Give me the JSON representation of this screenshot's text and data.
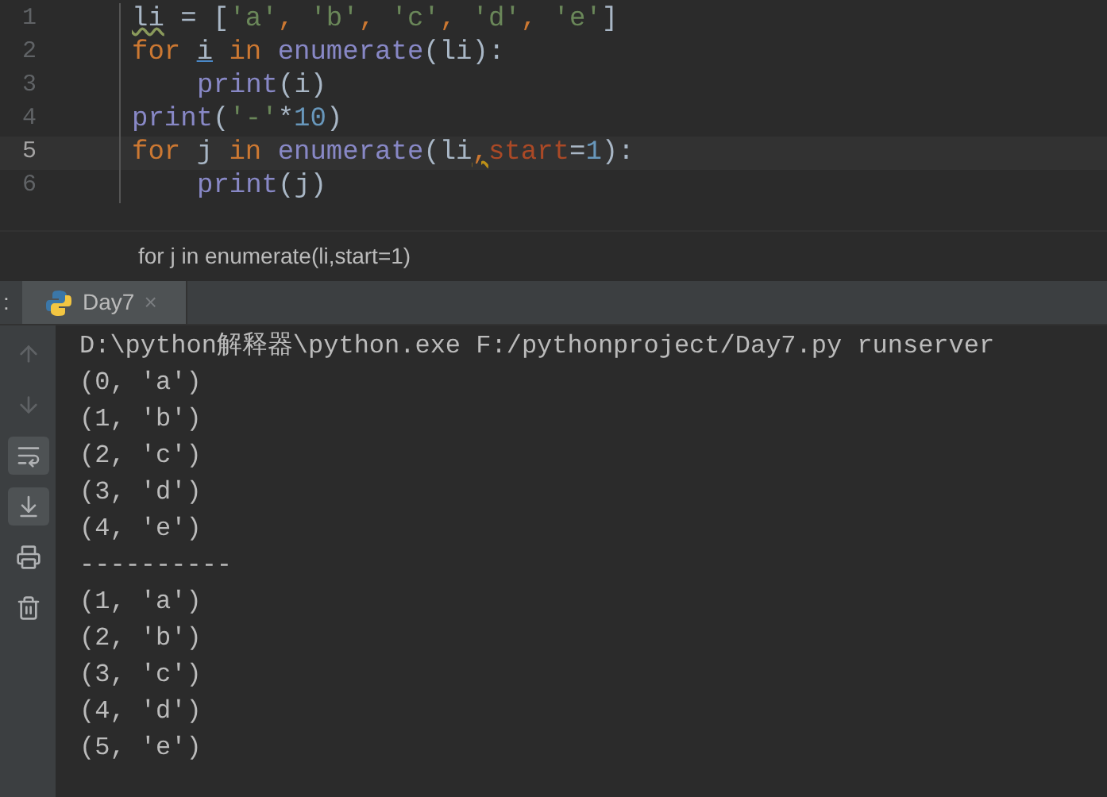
{
  "editor": {
    "lines": [
      {
        "number": "1",
        "current": false,
        "indented": false,
        "tokens": [
          {
            "kind": "name",
            "text": "li"
          },
          {
            "kind": "plain",
            "text": " = ["
          },
          {
            "kind": "string",
            "text": "'a'"
          },
          {
            "kind": "keyword",
            "text": ", "
          },
          {
            "kind": "string",
            "text": "'b'"
          },
          {
            "kind": "keyword",
            "text": ", "
          },
          {
            "kind": "string",
            "text": "'c'"
          },
          {
            "kind": "keyword",
            "text": ", "
          },
          {
            "kind": "string",
            "text": "'d'"
          },
          {
            "kind": "keyword",
            "text": ", "
          },
          {
            "kind": "string",
            "text": "'e'"
          },
          {
            "kind": "plain",
            "text": "]"
          }
        ]
      },
      {
        "number": "2",
        "current": false,
        "indented": false,
        "tokens": [
          {
            "kind": "keyword",
            "text": "for "
          },
          {
            "kind": "var",
            "text": "i"
          },
          {
            "kind": "keyword",
            "text": " in "
          },
          {
            "kind": "func",
            "text": "enumerate"
          },
          {
            "kind": "plain",
            "text": "(li):"
          }
        ]
      },
      {
        "number": "3",
        "current": false,
        "indented": true,
        "tokens": [
          {
            "kind": "func",
            "text": "print"
          },
          {
            "kind": "plain",
            "text": "(i)"
          }
        ]
      },
      {
        "number": "4",
        "current": false,
        "indented": false,
        "tokens": [
          {
            "kind": "func",
            "text": "print"
          },
          {
            "kind": "plain",
            "text": "("
          },
          {
            "kind": "string",
            "text": "'-'"
          },
          {
            "kind": "plain",
            "text": "*"
          },
          {
            "kind": "number",
            "text": "10"
          },
          {
            "kind": "plain",
            "text": ")"
          }
        ]
      },
      {
        "number": "5",
        "current": true,
        "indented": false,
        "tokens": [
          {
            "kind": "keyword",
            "text": "for "
          },
          {
            "kind": "plain",
            "text": "j "
          },
          {
            "kind": "keyword",
            "text": "in "
          },
          {
            "kind": "func",
            "text": "enumerate"
          },
          {
            "kind": "plain",
            "text": "(li"
          },
          {
            "kind": "warn",
            "text": ","
          },
          {
            "kind": "param",
            "text": "start"
          },
          {
            "kind": "plain",
            "text": "="
          },
          {
            "kind": "number",
            "text": "1"
          },
          {
            "kind": "plain",
            "text": "):"
          }
        ]
      },
      {
        "number": "6",
        "current": false,
        "indented": true,
        "tokens": [
          {
            "kind": "func",
            "text": "print"
          },
          {
            "kind": "plain",
            "text": "(j)"
          }
        ]
      }
    ]
  },
  "breadcrumb": "for j in enumerate(li,start=1)",
  "run_panel": {
    "label": ":",
    "tabs": [
      {
        "label": "Day7",
        "selected": true,
        "close": "×"
      }
    ],
    "tools": [
      {
        "kind": "up",
        "selected": false
      },
      {
        "kind": "down",
        "selected": false
      },
      {
        "kind": "wrap",
        "selected": true
      },
      {
        "kind": "scroll",
        "selected": true
      },
      {
        "kind": "print",
        "selected": false
      },
      {
        "kind": "trash",
        "selected": false
      }
    ],
    "output": [
      "D:\\python解释器\\python.exe F:/pythonproject/Day7.py runserver",
      "(0, 'a')",
      "(1, 'b')",
      "(2, 'c')",
      "(3, 'd')",
      "(4, 'e')",
      "----------",
      "(1, 'a')",
      "(2, 'b')",
      "(3, 'c')",
      "(4, 'd')",
      "(5, 'e')"
    ]
  }
}
